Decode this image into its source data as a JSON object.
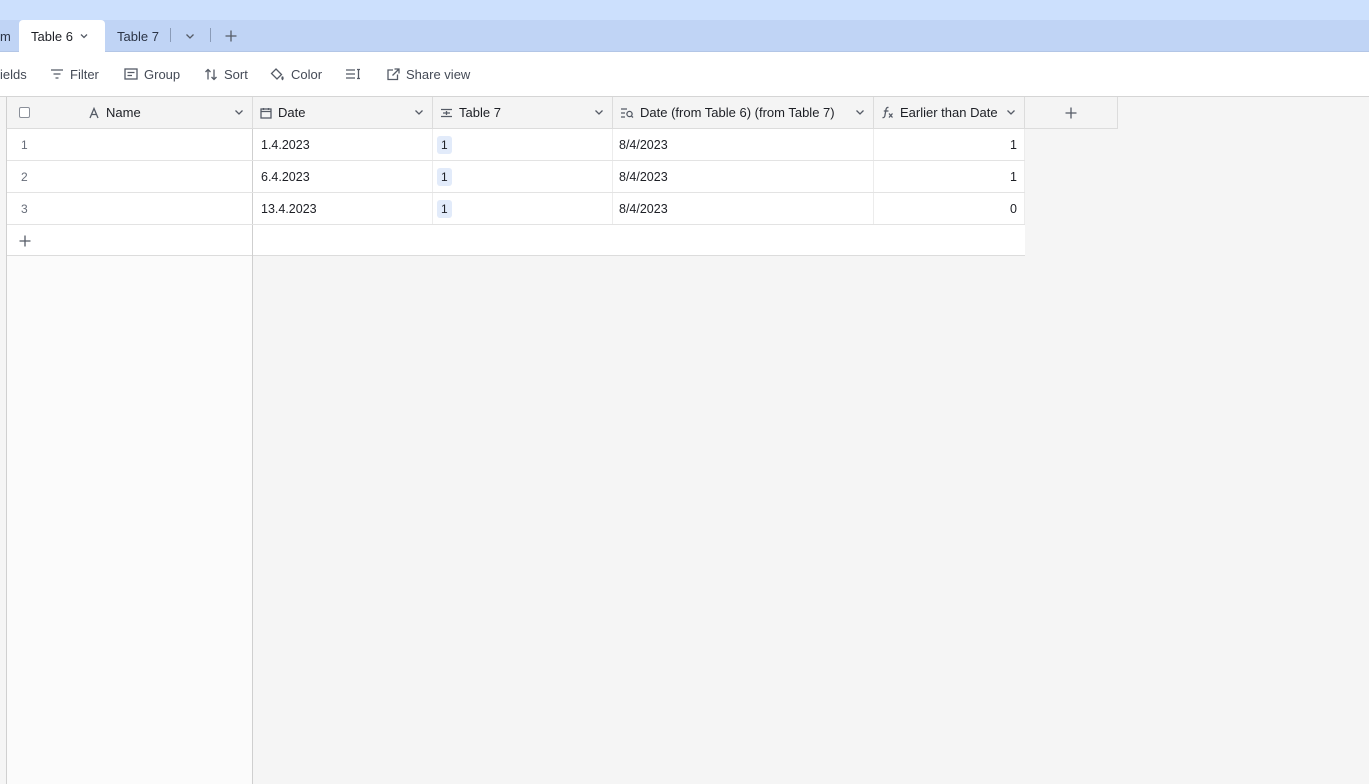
{
  "tabs": {
    "partial_label": "m",
    "active": {
      "label": "Table 6"
    },
    "inactive": {
      "label": "Table 7"
    }
  },
  "toolbar": {
    "fields_label": "ields",
    "filter_label": "Filter",
    "group_label": "Group",
    "sort_label": "Sort",
    "color_label": "Color",
    "share_label": "Share view"
  },
  "columns": {
    "name": "Name",
    "date": "Date",
    "table7": "Table 7",
    "lookup": "Date (from Table 6) (from Table 7)",
    "formula": "Earlier than Date"
  },
  "rows": [
    {
      "num": "1",
      "name": "",
      "date": "1.4.2023",
      "table7": "1",
      "lookup": "8/4/2023",
      "formula": "1"
    },
    {
      "num": "2",
      "name": "",
      "date": "6.4.2023",
      "table7": "1",
      "lookup": "8/4/2023",
      "formula": "1"
    },
    {
      "num": "3",
      "name": "",
      "date": "13.4.2023",
      "table7": "1",
      "lookup": "8/4/2023",
      "formula": "0"
    }
  ],
  "colors": {
    "tabbar": "#c0d4f5",
    "topbar": "#cce0fd",
    "chip": "#e2ebfa"
  }
}
